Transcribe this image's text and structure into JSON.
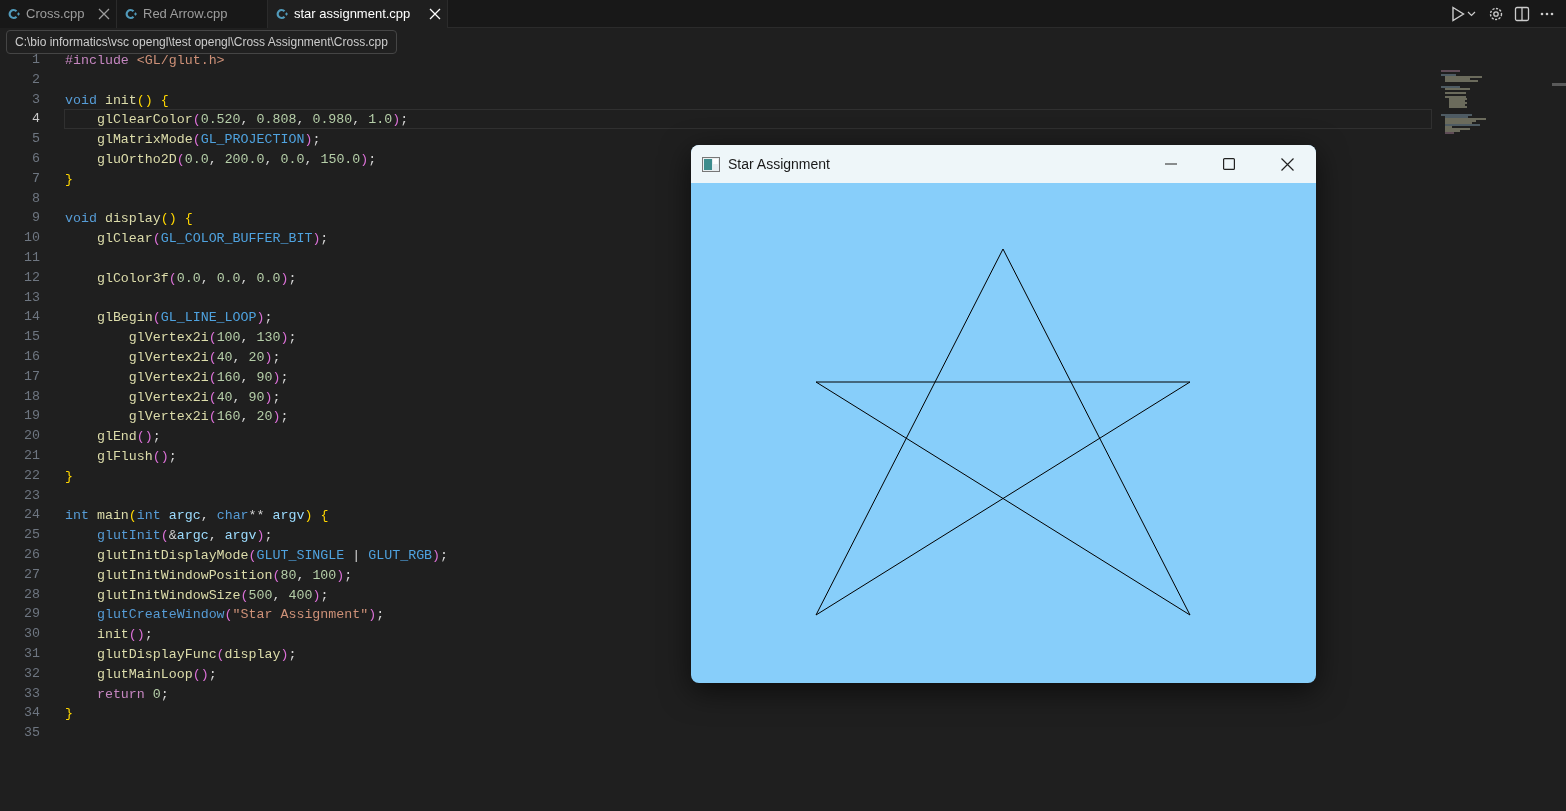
{
  "tabs": [
    {
      "label": "Cross.cpp",
      "selected": false,
      "closable": true
    },
    {
      "label": "Red Arrow.cpp",
      "selected": false,
      "closable": false
    },
    {
      "label": "star assignment.cpp",
      "selected": true,
      "closable": true
    }
  ],
  "tooltip": "C:\\bio informatics\\vsc opengl\\test opengl\\Cross Assignment\\Cross.cpp",
  "editor": {
    "lines": [
      {
        "number": "1",
        "active": false,
        "tokens": [
          {
            "kind": "ctl",
            "text": "#include"
          },
          {
            "kind": "str",
            "text": " <GL/glut.h>"
          }
        ]
      },
      {
        "number": "2",
        "active": false
      },
      {
        "number": "3",
        "active": false,
        "tokens": [
          {
            "kind": "kw",
            "text": "void"
          },
          {
            "kind": "fn",
            "text": " init"
          },
          {
            "kind": "b1",
            "text": "()"
          },
          {
            "kind": "b1",
            "text": " {"
          }
        ]
      },
      {
        "number": "4",
        "active": true,
        "tokens": [
          {
            "kind": "fn",
            "text": "    glClearColor"
          },
          {
            "kind": "b2",
            "text": "("
          },
          {
            "kind": "num",
            "text": "0.520"
          },
          {
            "kind": "p",
            "text": ", "
          },
          {
            "kind": "num",
            "text": "0.808"
          },
          {
            "kind": "p",
            "text": ", "
          },
          {
            "kind": "num",
            "text": "0.980"
          },
          {
            "kind": "p",
            "text": ", "
          },
          {
            "kind": "num",
            "text": "1.0"
          },
          {
            "kind": "b2",
            "text": ")"
          },
          {
            "kind": "p",
            "text": ";"
          }
        ]
      },
      {
        "number": "5",
        "active": false,
        "tokens": [
          {
            "kind": "fn",
            "text": "    glMatrixMode"
          },
          {
            "kind": "b2",
            "text": "("
          },
          {
            "kind": "const",
            "text": "GL_PROJECTION"
          },
          {
            "kind": "b2",
            "text": ")"
          },
          {
            "kind": "p",
            "text": ";"
          }
        ]
      },
      {
        "number": "6",
        "active": false,
        "tokens": [
          {
            "kind": "fn",
            "text": "    gluOrtho2D"
          },
          {
            "kind": "b2",
            "text": "("
          },
          {
            "kind": "num",
            "text": "0.0"
          },
          {
            "kind": "p",
            "text": ", "
          },
          {
            "kind": "num",
            "text": "200.0"
          },
          {
            "kind": "p",
            "text": ", "
          },
          {
            "kind": "num",
            "text": "0.0"
          },
          {
            "kind": "p",
            "text": ", "
          },
          {
            "kind": "num",
            "text": "150.0"
          },
          {
            "kind": "b2",
            "text": ")"
          },
          {
            "kind": "p",
            "text": ";"
          }
        ]
      },
      {
        "number": "7",
        "active": false,
        "tokens": [
          {
            "kind": "b1",
            "text": "}"
          }
        ]
      },
      {
        "number": "8",
        "active": false
      },
      {
        "number": "9",
        "active": false,
        "tokens": [
          {
            "kind": "kw",
            "text": "void"
          },
          {
            "kind": "fn",
            "text": " display"
          },
          {
            "kind": "b1",
            "text": "()"
          },
          {
            "kind": "b1",
            "text": " {"
          }
        ]
      },
      {
        "number": "10",
        "active": false,
        "tokens": [
          {
            "kind": "fn",
            "text": "    glClear"
          },
          {
            "kind": "b2",
            "text": "("
          },
          {
            "kind": "const",
            "text": "GL_COLOR_BUFFER_BIT"
          },
          {
            "kind": "b2",
            "text": ")"
          },
          {
            "kind": "p",
            "text": ";"
          }
        ]
      },
      {
        "number": "11",
        "active": false
      },
      {
        "number": "12",
        "active": false,
        "tokens": [
          {
            "kind": "fn",
            "text": "    glColor3f"
          },
          {
            "kind": "b2",
            "text": "("
          },
          {
            "kind": "num",
            "text": "0.0"
          },
          {
            "kind": "p",
            "text": ", "
          },
          {
            "kind": "num",
            "text": "0.0"
          },
          {
            "kind": "p",
            "text": ", "
          },
          {
            "kind": "num",
            "text": "0.0"
          },
          {
            "kind": "b2",
            "text": ")"
          },
          {
            "kind": "p",
            "text": ";"
          }
        ]
      },
      {
        "number": "13",
        "active": false
      },
      {
        "number": "14",
        "active": false,
        "tokens": [
          {
            "kind": "fn",
            "text": "    glBegin"
          },
          {
            "kind": "b2",
            "text": "("
          },
          {
            "kind": "const",
            "text": "GL_LINE_LOOP"
          },
          {
            "kind": "b2",
            "text": ")"
          },
          {
            "kind": "p",
            "text": ";"
          }
        ]
      },
      {
        "number": "15",
        "active": false,
        "tokens": [
          {
            "kind": "fn",
            "text": "        glVertex2i"
          },
          {
            "kind": "b2",
            "text": "("
          },
          {
            "kind": "num",
            "text": "100"
          },
          {
            "kind": "p",
            "text": ", "
          },
          {
            "kind": "num",
            "text": "130"
          },
          {
            "kind": "b2",
            "text": ")"
          },
          {
            "kind": "p",
            "text": ";"
          }
        ]
      },
      {
        "number": "16",
        "active": false,
        "tokens": [
          {
            "kind": "fn",
            "text": "        glVertex2i"
          },
          {
            "kind": "b2",
            "text": "("
          },
          {
            "kind": "num",
            "text": "40"
          },
          {
            "kind": "p",
            "text": ", "
          },
          {
            "kind": "num",
            "text": "20"
          },
          {
            "kind": "b2",
            "text": ")"
          },
          {
            "kind": "p",
            "text": ";"
          }
        ]
      },
      {
        "number": "17",
        "active": false,
        "tokens": [
          {
            "kind": "fn",
            "text": "        glVertex2i"
          },
          {
            "kind": "b2",
            "text": "("
          },
          {
            "kind": "num",
            "text": "160"
          },
          {
            "kind": "p",
            "text": ", "
          },
          {
            "kind": "num",
            "text": "90"
          },
          {
            "kind": "b2",
            "text": ")"
          },
          {
            "kind": "p",
            "text": ";"
          }
        ]
      },
      {
        "number": "18",
        "active": false,
        "tokens": [
          {
            "kind": "fn",
            "text": "        glVertex2i"
          },
          {
            "kind": "b2",
            "text": "("
          },
          {
            "kind": "num",
            "text": "40"
          },
          {
            "kind": "p",
            "text": ", "
          },
          {
            "kind": "num",
            "text": "90"
          },
          {
            "kind": "b2",
            "text": ")"
          },
          {
            "kind": "p",
            "text": ";"
          }
        ]
      },
      {
        "number": "19",
        "active": false,
        "tokens": [
          {
            "kind": "fn",
            "text": "        glVertex2i"
          },
          {
            "kind": "b2",
            "text": "("
          },
          {
            "kind": "num",
            "text": "160"
          },
          {
            "kind": "p",
            "text": ", "
          },
          {
            "kind": "num",
            "text": "20"
          },
          {
            "kind": "b2",
            "text": ")"
          },
          {
            "kind": "p",
            "text": ";"
          }
        ]
      },
      {
        "number": "20",
        "active": false,
        "tokens": [
          {
            "kind": "fn",
            "text": "    glEnd"
          },
          {
            "kind": "b2",
            "text": "()"
          },
          {
            "kind": "p",
            "text": ";"
          }
        ]
      },
      {
        "number": "21",
        "active": false,
        "tokens": [
          {
            "kind": "fn",
            "text": "    glFlush"
          },
          {
            "kind": "b2",
            "text": "()"
          },
          {
            "kind": "p",
            "text": ";"
          }
        ]
      },
      {
        "number": "22",
        "active": false,
        "tokens": [
          {
            "kind": "b1",
            "text": "}"
          }
        ]
      },
      {
        "number": "23",
        "active": false
      },
      {
        "number": "24",
        "active": false,
        "tokens": [
          {
            "kind": "kw",
            "text": "int"
          },
          {
            "kind": "fn",
            "text": " main"
          },
          {
            "kind": "b1",
            "text": "("
          },
          {
            "kind": "kw",
            "text": "int"
          },
          {
            "kind": "var",
            "text": " argc"
          },
          {
            "kind": "p",
            "text": ", "
          },
          {
            "kind": "kw",
            "text": "char"
          },
          {
            "kind": "p",
            "text": "** "
          },
          {
            "kind": "var",
            "text": "argv"
          },
          {
            "kind": "b1",
            "text": ")"
          },
          {
            "kind": "b1",
            "text": " {"
          }
        ]
      },
      {
        "number": "25",
        "active": false,
        "tokens": [
          {
            "kind": "macro",
            "text": "    glutInit"
          },
          {
            "kind": "b2",
            "text": "("
          },
          {
            "kind": "p",
            "text": "&"
          },
          {
            "kind": "var",
            "text": "argc"
          },
          {
            "kind": "p",
            "text": ", "
          },
          {
            "kind": "var",
            "text": "argv"
          },
          {
            "kind": "b2",
            "text": ")"
          },
          {
            "kind": "p",
            "text": ";"
          }
        ]
      },
      {
        "number": "26",
        "active": false,
        "tokens": [
          {
            "kind": "fn",
            "text": "    glutInitDisplayMode"
          },
          {
            "kind": "b2",
            "text": "("
          },
          {
            "kind": "const",
            "text": "GLUT_SINGLE"
          },
          {
            "kind": "p",
            "text": " | "
          },
          {
            "kind": "const",
            "text": "GLUT_RGB"
          },
          {
            "kind": "b2",
            "text": ")"
          },
          {
            "kind": "p",
            "text": ";"
          }
        ]
      },
      {
        "number": "27",
        "active": false,
        "tokens": [
          {
            "kind": "fn",
            "text": "    glutInitWindowPosition"
          },
          {
            "kind": "b2",
            "text": "("
          },
          {
            "kind": "num",
            "text": "80"
          },
          {
            "kind": "p",
            "text": ", "
          },
          {
            "kind": "num",
            "text": "100"
          },
          {
            "kind": "b2",
            "text": ")"
          },
          {
            "kind": "p",
            "text": ";"
          }
        ]
      },
      {
        "number": "28",
        "active": false,
        "tokens": [
          {
            "kind": "fn",
            "text": "    glutInitWindowSize"
          },
          {
            "kind": "b2",
            "text": "("
          },
          {
            "kind": "num",
            "text": "500"
          },
          {
            "kind": "p",
            "text": ", "
          },
          {
            "kind": "num",
            "text": "400"
          },
          {
            "kind": "b2",
            "text": ")"
          },
          {
            "kind": "p",
            "text": ";"
          }
        ]
      },
      {
        "number": "29",
        "active": false,
        "tokens": [
          {
            "kind": "macro",
            "text": "    glutCreateWindow"
          },
          {
            "kind": "b2",
            "text": "("
          },
          {
            "kind": "str",
            "text": "\"Star Assignment\""
          },
          {
            "kind": "b2",
            "text": ")"
          },
          {
            "kind": "p",
            "text": ";"
          }
        ]
      },
      {
        "number": "30",
        "active": false,
        "tokens": [
          {
            "kind": "fn",
            "text": "    init"
          },
          {
            "kind": "b2",
            "text": "()"
          },
          {
            "kind": "p",
            "text": ";"
          }
        ]
      },
      {
        "number": "31",
        "active": false,
        "tokens": [
          {
            "kind": "fn",
            "text": "    glutDisplayFunc"
          },
          {
            "kind": "b2",
            "text": "("
          },
          {
            "kind": "fn",
            "text": "display"
          },
          {
            "kind": "b2",
            "text": ")"
          },
          {
            "kind": "p",
            "text": ";"
          }
        ]
      },
      {
        "number": "32",
        "active": false,
        "tokens": [
          {
            "kind": "fn",
            "text": "    glutMainLoop"
          },
          {
            "kind": "b2",
            "text": "()"
          },
          {
            "kind": "p",
            "text": ";"
          }
        ]
      },
      {
        "number": "33",
        "active": false,
        "tokens": [
          {
            "kind": "ctl",
            "text": "    return"
          },
          {
            "kind": "num",
            "text": " 0"
          },
          {
            "kind": "p",
            "text": ";"
          }
        ]
      },
      {
        "number": "34",
        "active": false,
        "tokens": [
          {
            "kind": "b1",
            "text": "}"
          }
        ]
      },
      {
        "number": "35",
        "active": false
      }
    ]
  },
  "glut_window": {
    "title": "Star Assignment"
  }
}
